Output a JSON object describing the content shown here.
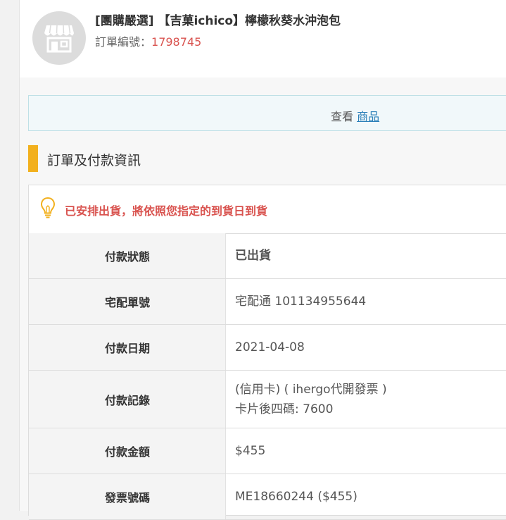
{
  "header": {
    "product_title": "[團購嚴選] 【吉菓ichico】檸檬秋葵水沖泡包",
    "order_label": "訂單編號：",
    "order_number": "1798745",
    "store_icon": "storefront-icon"
  },
  "view_bar": {
    "prefix": "查看",
    "link_label": "商品"
  },
  "section": {
    "title": "訂單及付款資訊"
  },
  "notice": {
    "icon": "lightbulb-icon",
    "text": "已安排出貨，將依照您指定的到貨日到貨"
  },
  "rows": [
    {
      "label": "付款狀態",
      "value": "已出貨"
    },
    {
      "label": "宅配單號",
      "value": "宅配通 101134955644"
    },
    {
      "label": "付款日期",
      "value": "2021-04-08"
    },
    {
      "label": "付款記錄",
      "value_line1": "(信用卡) ( ihergo代開發票 )",
      "value_line2": "卡片後四碼: 7600"
    },
    {
      "label": "付款金額",
      "value": "$455"
    },
    {
      "label": "發票號碼",
      "value": "ME18660244 ($455)"
    }
  ],
  "colors": {
    "accent_red": "#d9534f",
    "section_bar": "#f2b01e",
    "link_blue": "#2a7fb8"
  }
}
